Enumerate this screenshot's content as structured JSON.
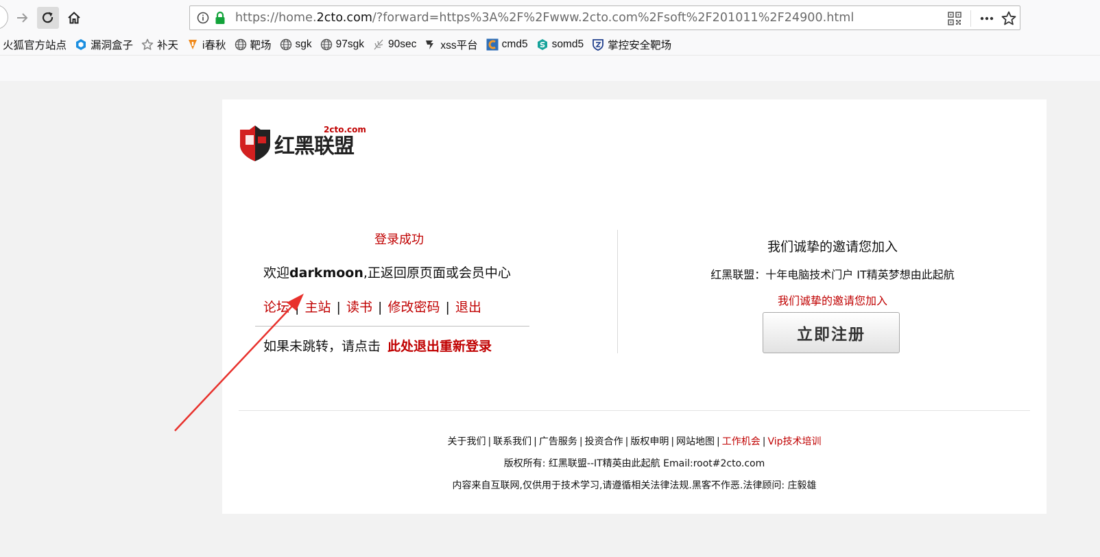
{
  "browser": {
    "url_prefix": "https://home.",
    "url_host": "2cto.com",
    "url_rest": "/?forward=https%3A%2F%2Fwww.2cto.com%2Fsoft%2F201011%2F24900.html",
    "icons": {
      "back": "back-icon",
      "forward": "forward-icon",
      "reload": "reload-icon",
      "home": "home-icon",
      "info": "info-icon",
      "lock": "lock-icon",
      "qr": "qr-code-icon",
      "more": "more-icon",
      "star": "star-icon"
    },
    "bookmarks": [
      {
        "label": "火狐官方站点",
        "icon": "none"
      },
      {
        "label": "漏洞盒子",
        "icon": "hexagon-icon",
        "color": "#1a8ee0"
      },
      {
        "label": "补天",
        "icon": "star-badge-icon",
        "color": "#888888"
      },
      {
        "label": "i春秋",
        "icon": "ichunqiu-icon",
        "color": "#f08a1c"
      },
      {
        "label": "靶场",
        "icon": "globe-icon",
        "color": "#555555"
      },
      {
        "label": "sgk",
        "icon": "globe-icon",
        "color": "#555555"
      },
      {
        "label": "97sgk",
        "icon": "globe-icon",
        "color": "#555555"
      },
      {
        "label": "90sec",
        "icon": "feather-icon",
        "color": "#777777"
      },
      {
        "label": "xss平台",
        "icon": "xss-icon",
        "color": "#333333"
      },
      {
        "label": "cmd5",
        "icon": "cmd5-icon",
        "color": "#e0791c"
      },
      {
        "label": "somd5",
        "icon": "somd5-icon",
        "color": "#17a39b"
      },
      {
        "label": "掌控安全靶场",
        "icon": "shield-icon",
        "color": "#1f3e8c"
      }
    ]
  },
  "page": {
    "logo_text": "红黑联盟",
    "logo_domain": "2cto.com",
    "success": "登录成功",
    "welcome_prefix": "欢迎",
    "username": "darkmoon",
    "welcome_suffix": ",正返回原页面或会员中心",
    "links": [
      "论坛",
      "主站",
      "读书",
      "修改密码",
      "退出"
    ],
    "redirect_text": "如果未跳转，请点击",
    "redirect_link": "此处退出重新登录",
    "invite_title": "我们诚挚的邀请您加入",
    "tagline": "红黑联盟：十年电脑技术门户 IT精英梦想由此起航",
    "invite_red": "我们诚挚的邀请您加入",
    "register_button": "立即注册",
    "footer_links": [
      {
        "label": "关于我们",
        "red": false
      },
      {
        "label": "联系我们",
        "red": false
      },
      {
        "label": "广告服务",
        "red": false
      },
      {
        "label": "投资合作",
        "red": false
      },
      {
        "label": "版权申明",
        "red": false
      },
      {
        "label": "网站地图",
        "red": false
      },
      {
        "label": "工作机会",
        "red": true
      },
      {
        "label": "Vip技术培训",
        "red": true
      }
    ],
    "copyright": "版权所有: 红黑联盟--IT精英由此起航 Email:root#2cto.com",
    "disclaimer": "内容来自互联网,仅供用于技术学习,请遵循相关法律法规.黑客不作恶.法律顾问: 庄毅雄"
  },
  "colors": {
    "accent_red": "#c00000",
    "annotation_arrow": "#e8312c"
  }
}
